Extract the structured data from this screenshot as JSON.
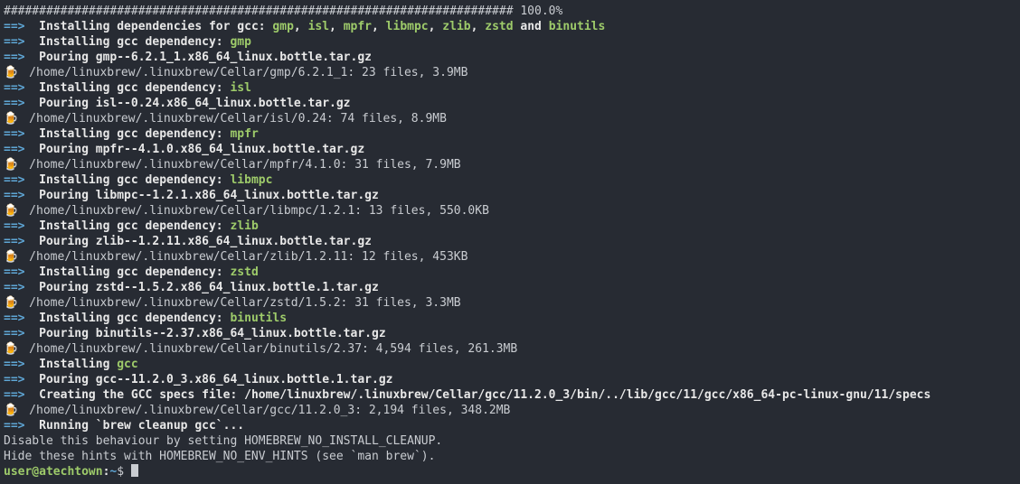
{
  "progress": {
    "bar": "########################################################################",
    "percent": "100.0%"
  },
  "deps_header": {
    "prefix": "Installing dependencies for gcc:",
    "list": [
      "gmp",
      "isl",
      "mpfr",
      "libmpc",
      "zlib",
      "zstd"
    ],
    "sep": ", ",
    "and": " and ",
    "last": "binutils"
  },
  "items": [
    {
      "dep_prefix": "Installing gcc dependency:",
      "name": "gmp",
      "pour": "Pouring gmp--6.2.1_1.x86_64_linux.bottle.tar.gz",
      "cellar": "/home/linuxbrew/.linuxbrew/Cellar/gmp/6.2.1_1: 23 files, 3.9MB"
    },
    {
      "dep_prefix": "Installing gcc dependency:",
      "name": "isl",
      "pour": "Pouring isl--0.24.x86_64_linux.bottle.tar.gz",
      "cellar": "/home/linuxbrew/.linuxbrew/Cellar/isl/0.24: 74 files, 8.9MB"
    },
    {
      "dep_prefix": "Installing gcc dependency:",
      "name": "mpfr",
      "pour": "Pouring mpfr--4.1.0.x86_64_linux.bottle.tar.gz",
      "cellar": "/home/linuxbrew/.linuxbrew/Cellar/mpfr/4.1.0: 31 files, 7.9MB"
    },
    {
      "dep_prefix": "Installing gcc dependency:",
      "name": "libmpc",
      "pour": "Pouring libmpc--1.2.1.x86_64_linux.bottle.tar.gz",
      "cellar": "/home/linuxbrew/.linuxbrew/Cellar/libmpc/1.2.1: 13 files, 550.0KB"
    },
    {
      "dep_prefix": "Installing gcc dependency:",
      "name": "zlib",
      "pour": "Pouring zlib--1.2.11.x86_64_linux.bottle.tar.gz",
      "cellar": "/home/linuxbrew/.linuxbrew/Cellar/zlib/1.2.11: 12 files, 453KB"
    },
    {
      "dep_prefix": "Installing gcc dependency:",
      "name": "zstd",
      "pour": "Pouring zstd--1.5.2.x86_64_linux.bottle.1.tar.gz",
      "cellar": "/home/linuxbrew/.linuxbrew/Cellar/zstd/1.5.2: 31 files, 3.3MB"
    },
    {
      "dep_prefix": "Installing gcc dependency:",
      "name": "binutils",
      "pour": "Pouring binutils--2.37.x86_64_linux.bottle.tar.gz",
      "cellar": "/home/linuxbrew/.linuxbrew/Cellar/binutils/2.37: 4,594 files, 261.3MB"
    }
  ],
  "gcc_block": {
    "install_prefix": "Installing",
    "name": "gcc",
    "pour": "Pouring gcc--11.2.0_3.x86_64_linux.bottle.1.tar.gz",
    "specs": "Creating the GCC specs file: /home/linuxbrew/.linuxbrew/Cellar/gcc/11.2.0_3/bin/../lib/gcc/11/gcc/x86_64-pc-linux-gnu/11/specs",
    "cellar": "/home/linuxbrew/.linuxbrew/Cellar/gcc/11.2.0_3: 2,194 files, 348.2MB"
  },
  "cleanup": {
    "running": "Running `brew cleanup gcc`...",
    "hint1": "Disable this behaviour by setting HOMEBREW_NO_INSTALL_CLEANUP.",
    "hint2": "Hide these hints with HOMEBREW_NO_ENV_HINTS (see `man brew`)."
  },
  "arrow": "==>",
  "beer": "🍺",
  "prompt": {
    "user": "user@atechtown",
    "colon": ":",
    "path": "~",
    "dollar": "$ "
  }
}
